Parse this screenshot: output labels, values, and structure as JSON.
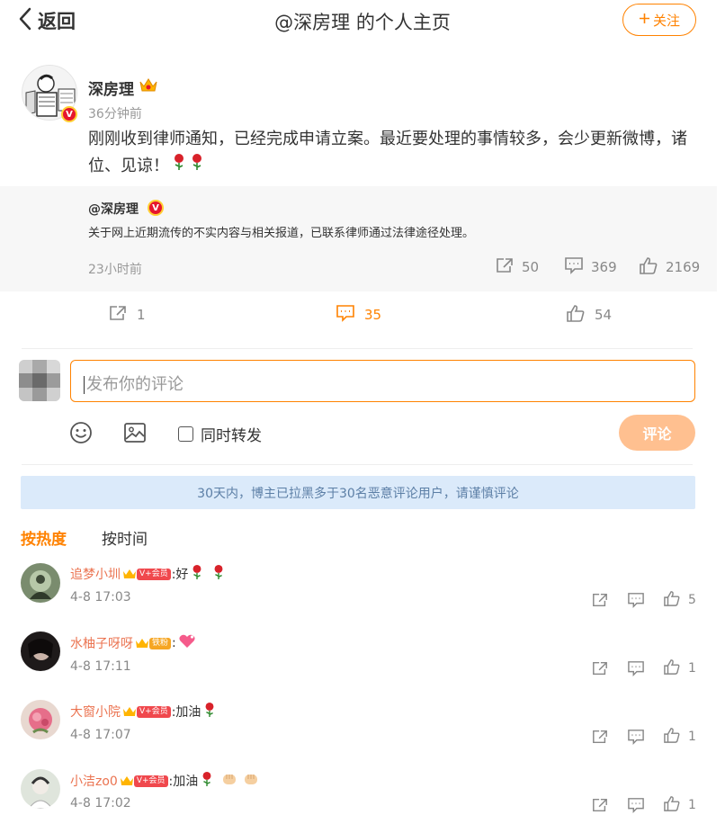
{
  "header": {
    "back_label": "返回",
    "title": "@深房理 的个人主页",
    "follow_label": "关注"
  },
  "post": {
    "author": "深房理",
    "time": "36分钟前",
    "text": "刚刚收到律师通知，已经完成申请立案。最近要处理的事情较多，会少更新微博，诸位、见谅！",
    "repost": {
      "author": "@深房理",
      "text": "关于网上近期流传的不实内容与相关报道，已联系律师通过法律途径处理。",
      "time": "23小时前",
      "reposts": "50",
      "comments": "369",
      "likes": "2169"
    },
    "actions": {
      "reposts": "1",
      "comments": "35",
      "likes": "54"
    }
  },
  "composer": {
    "placeholder": "发布你的评论",
    "also_repost_label": "同时转发",
    "submit_label": "评论"
  },
  "notice": "30天内，博主已拉黑多于30名恶意评论用户，请谨慎评论",
  "sort_tabs": [
    "按热度",
    "按时间"
  ],
  "comments": [
    {
      "user": "追梦小圳",
      "badge": "V+会员",
      "badge_type": "vip",
      "text": ":好",
      "time": "4-8 17:03",
      "likes": "5"
    },
    {
      "user": "水柚子呀呀",
      "badge": "铁粉",
      "badge_type": "fan",
      "text": ":",
      "time": "4-8 17:11",
      "likes": "1"
    },
    {
      "user": "大窗小院",
      "badge": "V+会员",
      "badge_type": "vip",
      "text": ":加油",
      "time": "4-8 17:07",
      "likes": "1"
    },
    {
      "user": "小洁zo0",
      "badge": "V+会员",
      "badge_type": "vip",
      "text": ":加油",
      "time": "4-8 17:02",
      "likes": "1"
    }
  ],
  "colors": {
    "accent": "#ff8200",
    "username": "#eb7350",
    "notice_bg": "#dbeafa",
    "submit_disabled": "#ffc090"
  },
  "icons": {
    "back": "chevron-left-icon",
    "repost": "share-icon",
    "comment": "comment-icon",
    "like": "thumbs-up-icon",
    "emoji": "smiley-icon",
    "image": "image-icon"
  }
}
